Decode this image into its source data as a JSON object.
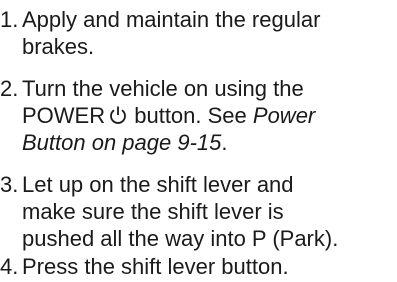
{
  "steps": [
    {
      "number": "1.",
      "line1": "Apply and maintain the regular",
      "line2": "brakes."
    },
    {
      "number": "2.",
      "line1": "Turn the vehicle on using the",
      "line2_prefix": "POWER",
      "line2_icon": "power-icon",
      "line2_suffix": " button. See ",
      "line2_ref": "Power",
      "line3_ref": "Button on page 9-15",
      "line3_end": "."
    },
    {
      "number": "3.",
      "line1": "Let up on the shift lever and",
      "line2": "make sure the shift lever is",
      "line3": "pushed all the way into P (Park)."
    },
    {
      "number": "4.",
      "line1": "Press the shift lever button."
    }
  ]
}
